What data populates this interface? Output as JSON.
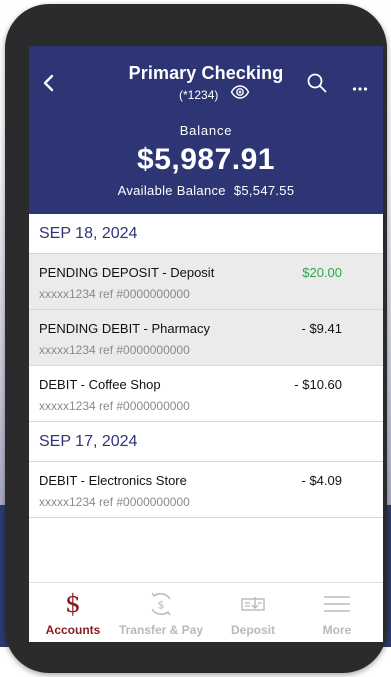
{
  "header": {
    "title": "Primary Checking",
    "account_mask": "(*1234)",
    "balance_label": "Balance",
    "balance": "$5,987.91",
    "available_label": "Available Balance",
    "available_balance": "$5,547.55"
  },
  "icons": {
    "back": "chevron-left-icon",
    "visibility": "eye-icon",
    "search": "search-icon",
    "more": "ellipsis-icon"
  },
  "groups": [
    {
      "date": "SEP 18, 2024",
      "transactions": [
        {
          "description": "PENDING DEPOSIT - Deposit",
          "reference": "xxxxx1234 ref #0000000000",
          "amount": "$20.00",
          "status": "pending"
        },
        {
          "description": "PENDING DEBIT - Pharmacy",
          "reference": "xxxxx1234 ref #0000000000",
          "amount": "- $9.41",
          "status": "pending"
        },
        {
          "description": "DEBIT - Coffee Shop",
          "reference": "xxxxx1234 ref #0000000000",
          "amount": "- $10.60",
          "status": "posted"
        }
      ]
    },
    {
      "date": "SEP 17, 2024",
      "transactions": [
        {
          "description": "DEBIT - Electronics Store",
          "reference": "xxxxx1234 ref #0000000000",
          "amount": "- $4.09",
          "status": "posted"
        }
      ]
    }
  ],
  "tabs": [
    {
      "label": "Accounts",
      "icon": "dollar-icon",
      "active": true
    },
    {
      "label": "Transfer & Pay",
      "icon": "transfer-icon",
      "active": false
    },
    {
      "label": "Deposit",
      "icon": "check-deposit-icon",
      "active": false
    },
    {
      "label": "More",
      "icon": "menu-icon",
      "active": false
    }
  ],
  "colors": {
    "header_bg": "#2e3575",
    "accent": "#8b1a1e",
    "credit": "#2ea84a",
    "pending_row_bg": "#ebebec",
    "date_text": "#2e3575"
  }
}
